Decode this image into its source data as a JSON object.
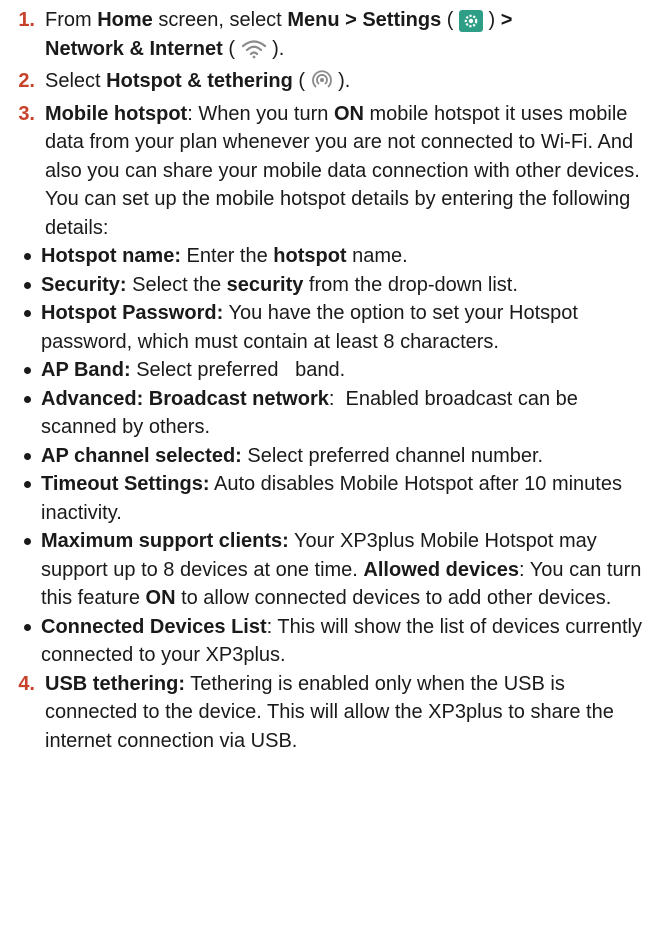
{
  "colors": {
    "step_number": "#c8412a",
    "settings_icon_bg": "#2f9e86"
  },
  "icons": [
    "settings-gear-icon",
    "wifi-icon",
    "hotspot-icon"
  ],
  "step1": {
    "num": "1.",
    "t1": "From ",
    "b1": "Home",
    "t2": " screen, select ",
    "b2": "Menu > Settings",
    "t3": " ( ",
    "t4": " ) ",
    "b3": ">",
    "b4": "Network & Internet",
    "t5": " ( ",
    "t6": " )."
  },
  "step2": {
    "num": "2.",
    "t1": "Select ",
    "b1": "Hotspot & tethering",
    "t2": " ( ",
    "t3": " )."
  },
  "step3": {
    "num": "3.",
    "b1": "Mobile hotspot",
    "t1": ": When you turn ",
    "b2": "ON",
    "t2": " mobile hotspot it uses mobile data from your plan whenever you are not connected to Wi-Fi. And also you can share your mobile data connection with other devices. You can set up the mobile hotspot details by entering the following details:",
    "bullets": {
      "name": {
        "b1": "Hotspot name:",
        "t1": " Enter the ",
        "b2": "hotspot",
        "t2": " name."
      },
      "security": {
        "b1": "Security:",
        "t1": " Select the ",
        "b2": "security",
        "t2": " from the drop-down list."
      },
      "password": {
        "b1": "Hotspot Password:",
        "t1": " You have the option to set your Hotspot password, which must contain at least 8 characters."
      },
      "band": {
        "b1": "AP Band:",
        "t1": " Select preferred   band."
      },
      "advanced": {
        "b1": "Advanced: Broadcast network",
        "t1": ":  Enabled broadcast can be scanned by others."
      },
      "channel": {
        "b1": "AP channel selected:",
        "t1": " Select preferred channel number."
      },
      "timeout": {
        "b1": "Timeout Settings:",
        "t1": " Auto disables Mobile Hotspot after 10 minutes inactivity."
      },
      "clients": {
        "b1": "Maximum support clients:",
        "t1": " Your XP3plus Mobile Hotspot may support up to 8 devices at one time. ",
        "b2": "Allowed devices",
        "t2": ": You can turn this feature ",
        "b3": "ON",
        "t3": " to allow connected devices to add other devices."
      },
      "devices": {
        "b1": "Connected Devices List",
        "t1": ": This will show the list of devices currently connected to your XP3plus."
      }
    }
  },
  "step4": {
    "num": "4.",
    "b1": "USB tethering:",
    "t1": " Tethering is enabled only when the USB is connected to the device. This will allow the XP3plus to share the internet connection via USB."
  }
}
